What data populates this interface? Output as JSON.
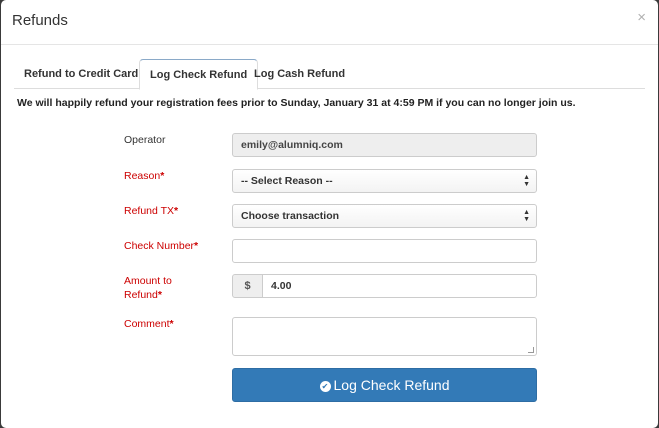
{
  "modal": {
    "title": "Refunds",
    "close_glyph": "×"
  },
  "tabs": [
    {
      "label": "Refund to Credit Card",
      "active": false
    },
    {
      "label": "Log Check Refund",
      "active": true
    },
    {
      "label": "Log Cash Refund",
      "active": false
    }
  ],
  "notice": "We will happily refund your registration fees prior to Sunday, January 31 at 4:59 PM if you can no longer join us.",
  "form": {
    "operator": {
      "label": "Operator",
      "value": "emily@alumniq.com"
    },
    "reason": {
      "label": "Reason",
      "required_mark": "*",
      "selected": "-- Select Reason --"
    },
    "refund_tx": {
      "label": "Refund TX",
      "required_mark": "*",
      "selected": "Choose transaction"
    },
    "check_number": {
      "label": "Check Number",
      "required_mark": "*",
      "value": ""
    },
    "amount": {
      "label_line1": "Amount to",
      "label_line2": "Refund",
      "required_mark": "*",
      "currency": "$",
      "value": "4.00"
    },
    "comment": {
      "label": "Comment",
      "required_mark": "*",
      "value": ""
    },
    "submit": {
      "label": "Log Check Refund",
      "icon": "check-circle-icon"
    }
  },
  "colors": {
    "required": "#cc0000",
    "primary_button": "#337ab7"
  }
}
